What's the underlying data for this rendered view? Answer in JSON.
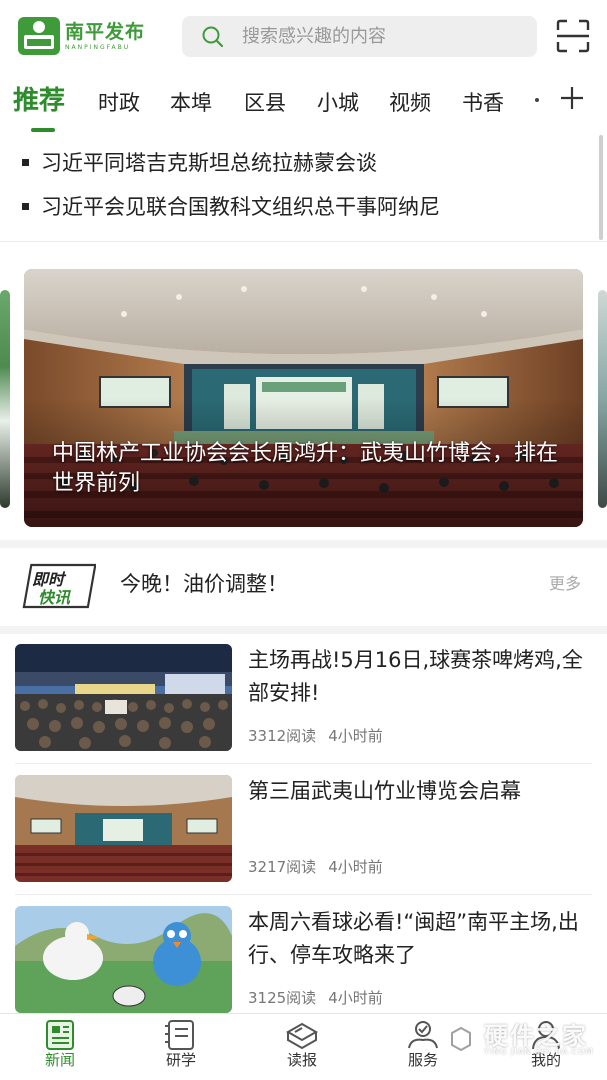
{
  "header": {
    "logo_name": "南平发布",
    "logo_subtitle": "NANPINGFABU",
    "search_placeholder": "搜索感兴趣的内容",
    "icons": {
      "search": "search-icon",
      "scan": "scan-icon"
    },
    "accent_color": "#2f8c2d"
  },
  "tabs": [
    {
      "label": "推荐",
      "active": true
    },
    {
      "label": "时政"
    },
    {
      "label": "本埠"
    },
    {
      "label": "区县"
    },
    {
      "label": "小城"
    },
    {
      "label": "视频"
    },
    {
      "label": "书香"
    }
  ],
  "headlines": [
    "习近平同塔吉克斯坦总统拉赫蒙会谈",
    "习近平会见联合国教科文组织总干事阿纳尼"
  ],
  "carousel": {
    "title": "中国林产工业协会会长周鸿升：武夷山竹博会，排在世界前列"
  },
  "flash": {
    "logo_text": "即时快讯",
    "text": "今晚！油价调整！",
    "more": "更多"
  },
  "news": [
    {
      "title": "主场再战!5月16日,球赛茶啤烤鸡,全部安排!",
      "reads": "3312阅读",
      "time": "4小时前"
    },
    {
      "title": "第三届武夷山竹业博览会启幕",
      "reads": "3217阅读",
      "time": "4小时前"
    },
    {
      "title": "本周六看球必看!“闽超”南平主场,出行、停车攻略来了",
      "reads": "3125阅读",
      "time": "4小时前"
    }
  ],
  "bottom_nav": [
    {
      "label": "新闻",
      "icon": "newspaper-icon",
      "active": true
    },
    {
      "label": "研学",
      "icon": "notebook-icon"
    },
    {
      "label": "读报",
      "icon": "paper-icon"
    },
    {
      "label": "服务",
      "icon": "service-icon"
    },
    {
      "label": "我的",
      "icon": "profile-icon"
    }
  ],
  "watermark": {
    "cn": "硬件之家",
    "en": "YING JIAN ZHI JIA.COM"
  }
}
